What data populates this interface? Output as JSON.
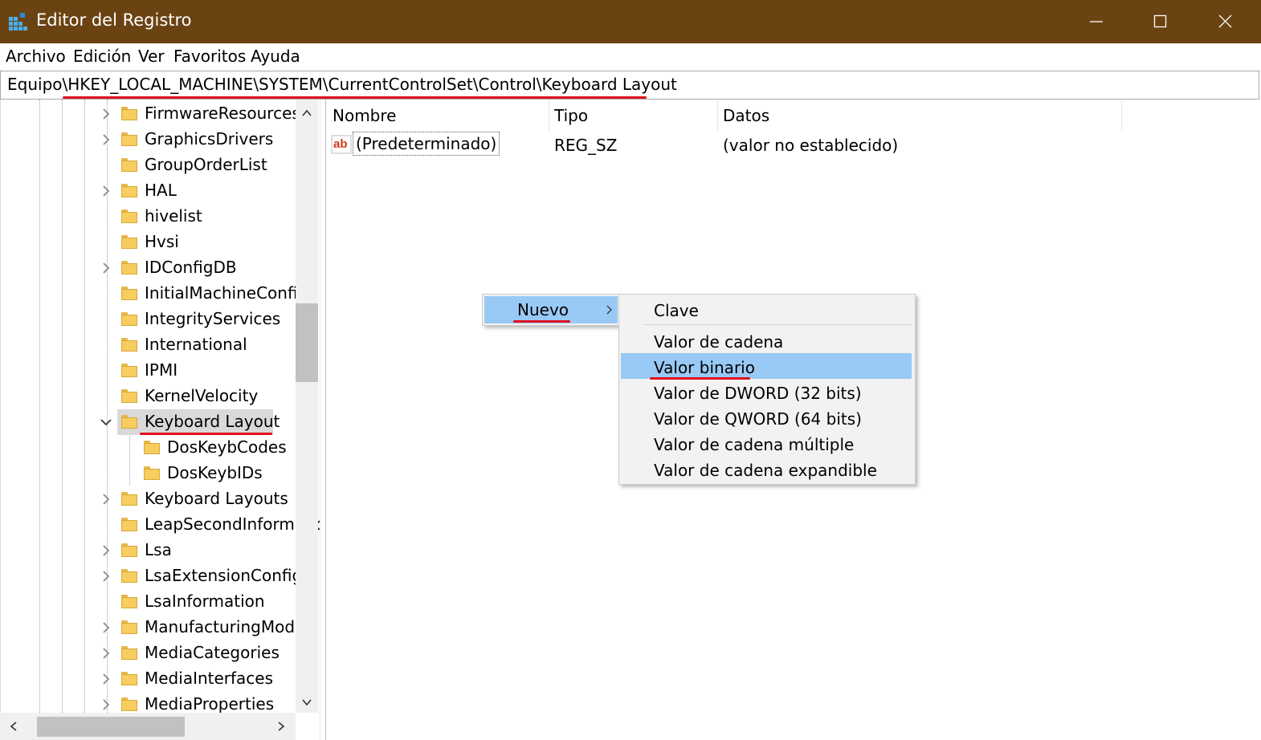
{
  "window": {
    "title": "Editor del Registro",
    "titlebar_color": "#6b4312"
  },
  "menubar": {
    "items": [
      "Archivo",
      "Edición",
      "Ver",
      "Favoritos",
      "Ayuda"
    ]
  },
  "address": {
    "path": "Equipo\\HKEY_LOCAL_MACHINE\\SYSTEM\\CurrentControlSet\\Control\\Keyboard Layout"
  },
  "tree": {
    "items": [
      {
        "label": "FirmwareResources",
        "expandable": true
      },
      {
        "label": "GraphicsDrivers",
        "expandable": true
      },
      {
        "label": "GroupOrderList",
        "expandable": false
      },
      {
        "label": "HAL",
        "expandable": true
      },
      {
        "label": "hivelist",
        "expandable": false
      },
      {
        "label": "Hvsi",
        "expandable": false
      },
      {
        "label": "IDConfigDB",
        "expandable": true
      },
      {
        "label": "InitialMachineConfig",
        "expandable": false
      },
      {
        "label": "IntegrityServices",
        "expandable": false
      },
      {
        "label": "International",
        "expandable": false
      },
      {
        "label": "IPMI",
        "expandable": false
      },
      {
        "label": "KernelVelocity",
        "expandable": false
      },
      {
        "label": "Keyboard Layout",
        "expandable": true,
        "expanded": true,
        "selected": true
      },
      {
        "label": "DosKeybCodes",
        "expandable": false,
        "child": true
      },
      {
        "label": "DosKeybIDs",
        "expandable": false,
        "child": true
      },
      {
        "label": "Keyboard Layouts",
        "expandable": true
      },
      {
        "label": "LeapSecondInformation",
        "expandable": false
      },
      {
        "label": "Lsa",
        "expandable": true
      },
      {
        "label": "LsaExtensionConfig",
        "expandable": true
      },
      {
        "label": "LsaInformation",
        "expandable": false
      },
      {
        "label": "ManufacturingMode",
        "expandable": true
      },
      {
        "label": "MediaCategories",
        "expandable": true
      },
      {
        "label": "MediaInterfaces",
        "expandable": true
      },
      {
        "label": "MediaProperties",
        "expandable": true
      }
    ]
  },
  "list": {
    "columns": [
      "Nombre",
      "Tipo",
      "Datos"
    ],
    "rows": [
      {
        "name": "(Predeterminado)",
        "type": "REG_SZ",
        "data": "(valor no establecido)",
        "icon": "string-value-icon"
      }
    ]
  },
  "context_menu": {
    "item": "Nuevo"
  },
  "submenu": {
    "items": [
      "Clave",
      "Valor de cadena",
      "Valor binario",
      "Valor de DWORD (32 bits)",
      "Valor de QWORD (64 bits)",
      "Valor de cadena múltiple",
      "Valor de cadena expandible"
    ],
    "highlighted": "Valor binario",
    "highlight_color": "#99c9f5"
  },
  "annotation_color": "#e0101e"
}
